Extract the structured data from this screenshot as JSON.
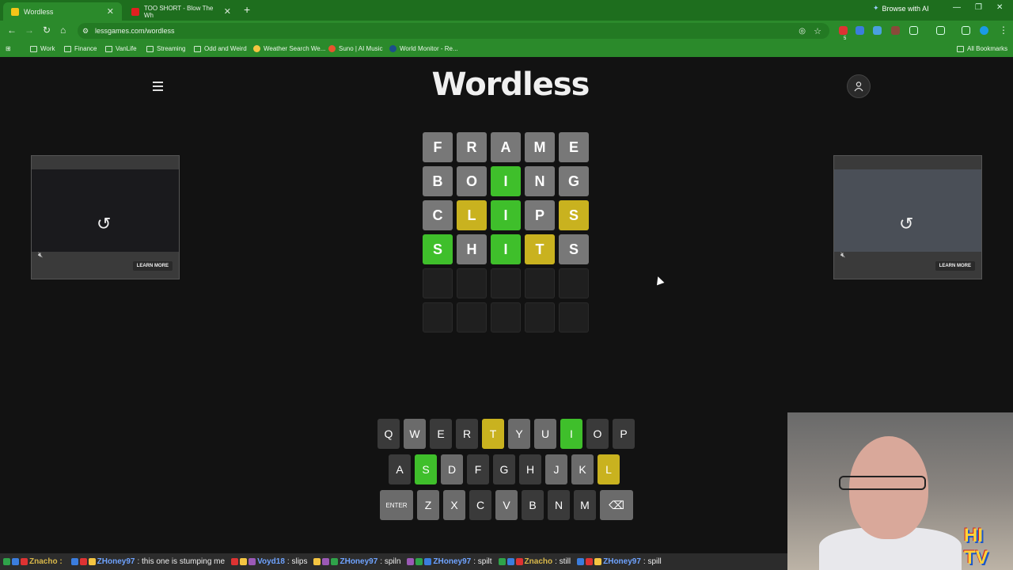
{
  "browser": {
    "tabs": [
      {
        "title": "Wordless",
        "active": true
      },
      {
        "title": "TOO SHORT - Blow The Wh",
        "active": false
      }
    ],
    "browse_ai_label": "Browse with AI",
    "url": "lessgames.com/wordless",
    "bookmarks": [
      "Work",
      "Finance",
      "VanLife",
      "Streaming",
      "Odd and Weird",
      "Weather Search We...",
      "Suno | AI Music",
      "World Monitor - Re..."
    ],
    "all_bookmarks_label": "All Bookmarks",
    "extension_badge": "5"
  },
  "game": {
    "logo": "Wordless",
    "board": [
      [
        {
          "l": "F",
          "s": "absent"
        },
        {
          "l": "R",
          "s": "absent"
        },
        {
          "l": "A",
          "s": "absent"
        },
        {
          "l": "M",
          "s": "absent"
        },
        {
          "l": "E",
          "s": "absent"
        }
      ],
      [
        {
          "l": "B",
          "s": "absent"
        },
        {
          "l": "O",
          "s": "absent"
        },
        {
          "l": "I",
          "s": "correct"
        },
        {
          "l": "N",
          "s": "absent"
        },
        {
          "l": "G",
          "s": "absent"
        }
      ],
      [
        {
          "l": "C",
          "s": "absent"
        },
        {
          "l": "L",
          "s": "present"
        },
        {
          "l": "I",
          "s": "correct"
        },
        {
          "l": "P",
          "s": "absent"
        },
        {
          "l": "S",
          "s": "present"
        }
      ],
      [
        {
          "l": "S",
          "s": "correct"
        },
        {
          "l": "H",
          "s": "absent"
        },
        {
          "l": "I",
          "s": "correct"
        },
        {
          "l": "T",
          "s": "present"
        },
        {
          "l": "S",
          "s": "absent"
        }
      ],
      [
        {
          "l": "",
          "s": "empty"
        },
        {
          "l": "",
          "s": "empty"
        },
        {
          "l": "",
          "s": "empty"
        },
        {
          "l": "",
          "s": "empty"
        },
        {
          "l": "",
          "s": "empty"
        }
      ],
      [
        {
          "l": "",
          "s": "empty"
        },
        {
          "l": "",
          "s": "empty"
        },
        {
          "l": "",
          "s": "empty"
        },
        {
          "l": "",
          "s": "empty"
        },
        {
          "l": "",
          "s": "empty"
        }
      ]
    ],
    "keyboard": [
      [
        {
          "k": "Q",
          "s": "unused"
        },
        {
          "k": "W",
          "s": "absent"
        },
        {
          "k": "E",
          "s": "unused"
        },
        {
          "k": "R",
          "s": "unused"
        },
        {
          "k": "T",
          "s": "present"
        },
        {
          "k": "Y",
          "s": "absent"
        },
        {
          "k": "U",
          "s": "absent"
        },
        {
          "k": "I",
          "s": "correct"
        },
        {
          "k": "O",
          "s": "unused"
        },
        {
          "k": "P",
          "s": "unused"
        }
      ],
      [
        {
          "k": "A",
          "s": "unused"
        },
        {
          "k": "S",
          "s": "correct"
        },
        {
          "k": "D",
          "s": "absent"
        },
        {
          "k": "F",
          "s": "unused"
        },
        {
          "k": "G",
          "s": "unused"
        },
        {
          "k": "H",
          "s": "unused"
        },
        {
          "k": "J",
          "s": "absent"
        },
        {
          "k": "K",
          "s": "absent"
        },
        {
          "k": "L",
          "s": "present"
        }
      ],
      [
        {
          "k": "ENTER",
          "s": "absent"
        },
        {
          "k": "Z",
          "s": "absent"
        },
        {
          "k": "X",
          "s": "absent"
        },
        {
          "k": "C",
          "s": "unused"
        },
        {
          "k": "V",
          "s": "absent"
        },
        {
          "k": "B",
          "s": "unused"
        },
        {
          "k": "N",
          "s": "unused"
        },
        {
          "k": "M",
          "s": "unused"
        },
        {
          "k": "⌫",
          "s": "absent"
        }
      ]
    ]
  },
  "ads": [
    {
      "learn_more": "LEARN MORE"
    },
    {
      "learn_more": "LEARN MORE"
    }
  ],
  "chat": [
    {
      "user": "Znacho :",
      "msg": ""
    },
    {
      "user": "ZHoney97",
      "msg": ": this one is stumping me"
    },
    {
      "user": "Voyd18",
      "msg": ": slips"
    },
    {
      "user": "ZHoney97",
      "msg": ": spiln"
    },
    {
      "user": "ZHoney97",
      "msg": ": spilt"
    },
    {
      "user": "Znacho",
      "msg": ": still"
    },
    {
      "user": "ZHoney97",
      "msg": ": spill"
    }
  ],
  "overlay_logo": "HI TV",
  "colors": {
    "correct": "#3fbf2b",
    "present": "#c9b21f",
    "absent": "#787878",
    "browser_green": "#2b8a2b"
  }
}
